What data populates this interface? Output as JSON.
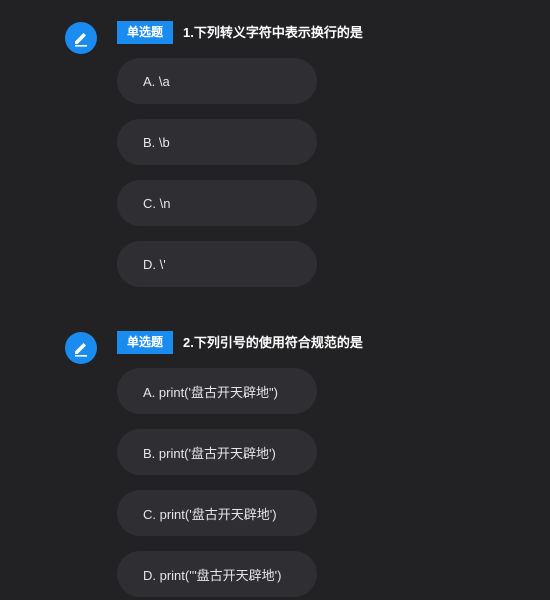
{
  "questions": [
    {
      "type_label": "单选题",
      "title": "1.下列转义字符中表示换行的是",
      "options": [
        "A. \\a",
        "B. \\b",
        "C. \\n",
        "D. \\'"
      ]
    },
    {
      "type_label": "单选题",
      "title": "2.下列引号的使用符合规范的是",
      "options": [
        "A. print('盘古开天辟地\")",
        "B. print('盘古开天辟地')",
        "C. print('盘古开天辟地')",
        "D. print('''盘古开天辟地')"
      ]
    }
  ],
  "colors": {
    "background": "#222224",
    "accent": "#1a8cf0",
    "option_bg": "#2f2f33"
  },
  "icons": {
    "question_marker": "edit-pencil-icon"
  }
}
